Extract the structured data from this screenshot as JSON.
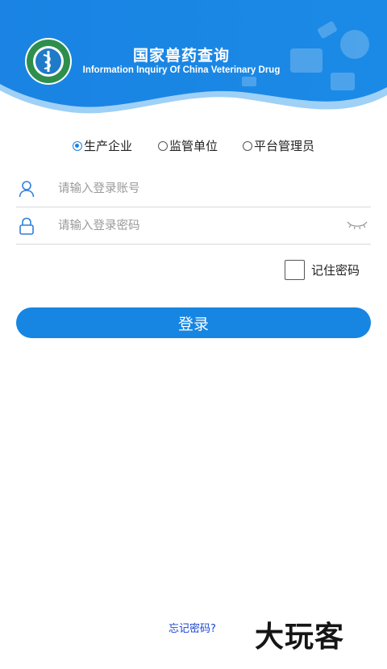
{
  "header": {
    "title": "国家兽药查询",
    "subtitle": "Information Inquiry Of China Veterinary Drug",
    "logo_icon": "vet-drug-emblem-icon"
  },
  "roles": [
    {
      "label": "生产企业",
      "checked": true
    },
    {
      "label": "监管单位",
      "checked": false
    },
    {
      "label": "平台管理员",
      "checked": false
    }
  ],
  "account": {
    "placeholder": "请输入登录账号",
    "icon": "user-icon"
  },
  "password": {
    "placeholder": "请输入登录密码",
    "icon": "lock-icon",
    "toggle_icon": "eye-closed-icon"
  },
  "remember": {
    "label": "记住密码",
    "checked": false
  },
  "login_button": {
    "label": "登录"
  },
  "forgot_link": {
    "label": "忘记密码?"
  },
  "watermark": {
    "text": "大玩客"
  },
  "colors": {
    "primary": "#1686e2",
    "header_light": "#3aa4f5",
    "link": "#1a45d8"
  }
}
